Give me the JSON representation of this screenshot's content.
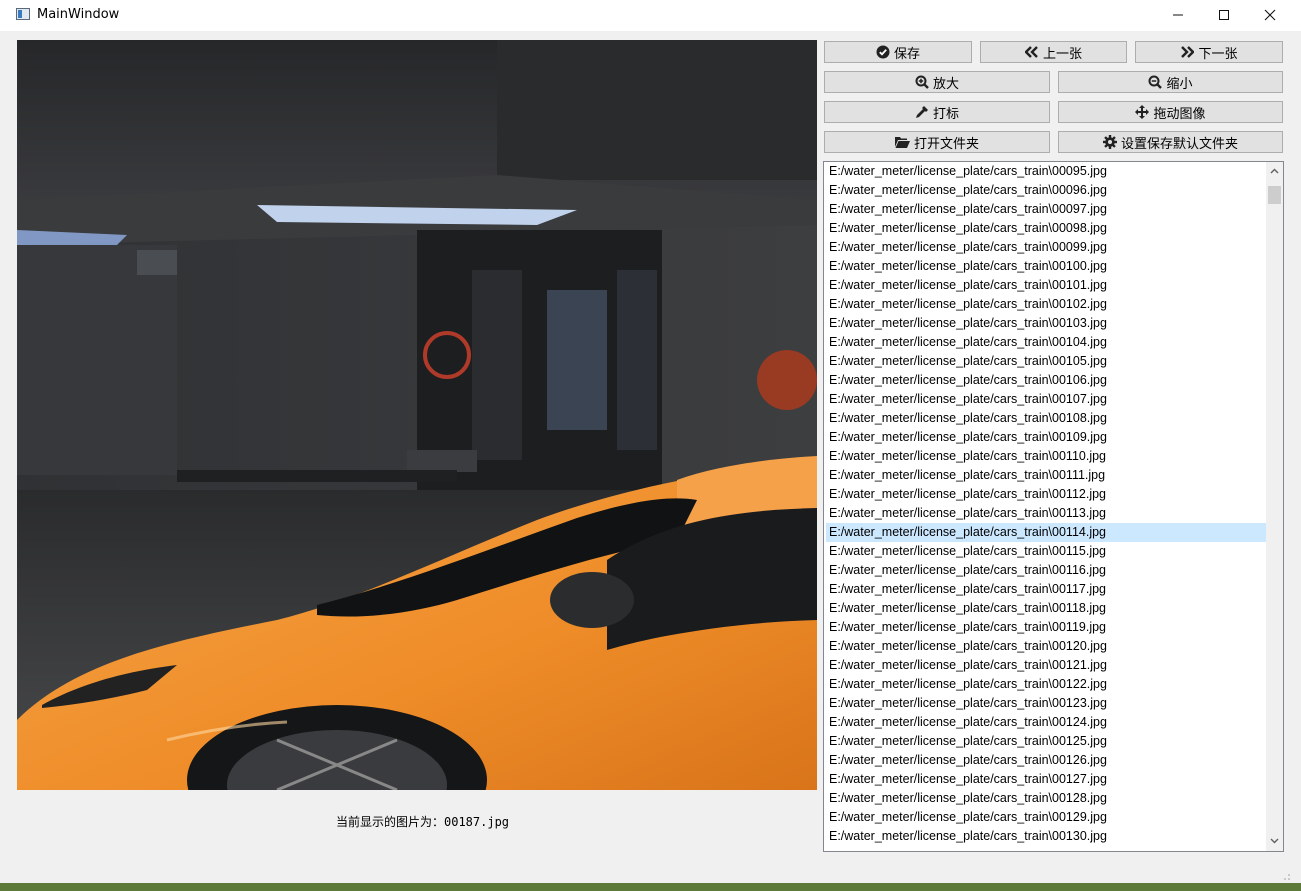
{
  "window": {
    "title": "MainWindow",
    "minimize_glyph": "—",
    "maximize_glyph": "☐",
    "close_glyph": "✕"
  },
  "toolbar": {
    "save_label": "保存",
    "prev_label": "上一张",
    "next_label": "下一张",
    "zoom_in_label": "放大",
    "zoom_out_label": "缩小",
    "annotate_label": "打标",
    "drag_label": "拖动图像",
    "open_folder_label": "打开文件夹",
    "set_default_folder_label": "设置保存默认文件夹"
  },
  "status": {
    "text": "当前显示的图片为：00187.jpg"
  },
  "file_list": {
    "selected_index": 19,
    "items": [
      "E:/water_meter/license_plate/cars_train\\00095.jpg",
      "E:/water_meter/license_plate/cars_train\\00096.jpg",
      "E:/water_meter/license_plate/cars_train\\00097.jpg",
      "E:/water_meter/license_plate/cars_train\\00098.jpg",
      "E:/water_meter/license_plate/cars_train\\00099.jpg",
      "E:/water_meter/license_plate/cars_train\\00100.jpg",
      "E:/water_meter/license_plate/cars_train\\00101.jpg",
      "E:/water_meter/license_plate/cars_train\\00102.jpg",
      "E:/water_meter/license_plate/cars_train\\00103.jpg",
      "E:/water_meter/license_plate/cars_train\\00104.jpg",
      "E:/water_meter/license_plate/cars_train\\00105.jpg",
      "E:/water_meter/license_plate/cars_train\\00106.jpg",
      "E:/water_meter/license_plate/cars_train\\00107.jpg",
      "E:/water_meter/license_plate/cars_train\\00108.jpg",
      "E:/water_meter/license_plate/cars_train\\00109.jpg",
      "E:/water_meter/license_plate/cars_train\\00110.jpg",
      "E:/water_meter/license_plate/cars_train\\00111.jpg",
      "E:/water_meter/license_plate/cars_train\\00112.jpg",
      "E:/water_meter/license_plate/cars_train\\00113.jpg",
      "E:/water_meter/license_plate/cars_train\\00114.jpg",
      "E:/water_meter/license_plate/cars_train\\00115.jpg",
      "E:/water_meter/license_plate/cars_train\\00116.jpg",
      "E:/water_meter/license_plate/cars_train\\00117.jpg",
      "E:/water_meter/license_plate/cars_train\\00118.jpg",
      "E:/water_meter/license_plate/cars_train\\00119.jpg",
      "E:/water_meter/license_plate/cars_train\\00120.jpg",
      "E:/water_meter/license_plate/cars_train\\00121.jpg",
      "E:/water_meter/license_plate/cars_train\\00122.jpg",
      "E:/water_meter/license_plate/cars_train\\00123.jpg",
      "E:/water_meter/license_plate/cars_train\\00124.jpg",
      "E:/water_meter/license_plate/cars_train\\00125.jpg",
      "E:/water_meter/license_plate/cars_train\\00126.jpg",
      "E:/water_meter/license_plate/cars_train\\00127.jpg",
      "E:/water_meter/license_plate/cars_train\\00128.jpg",
      "E:/water_meter/license_plate/cars_train\\00129.jpg",
      "E:/water_meter/license_plate/cars_train\\00130.jpg"
    ]
  },
  "colors": {
    "selection": "#cce8ff",
    "button_bg": "#e1e1e1",
    "car": "#f0922e"
  }
}
